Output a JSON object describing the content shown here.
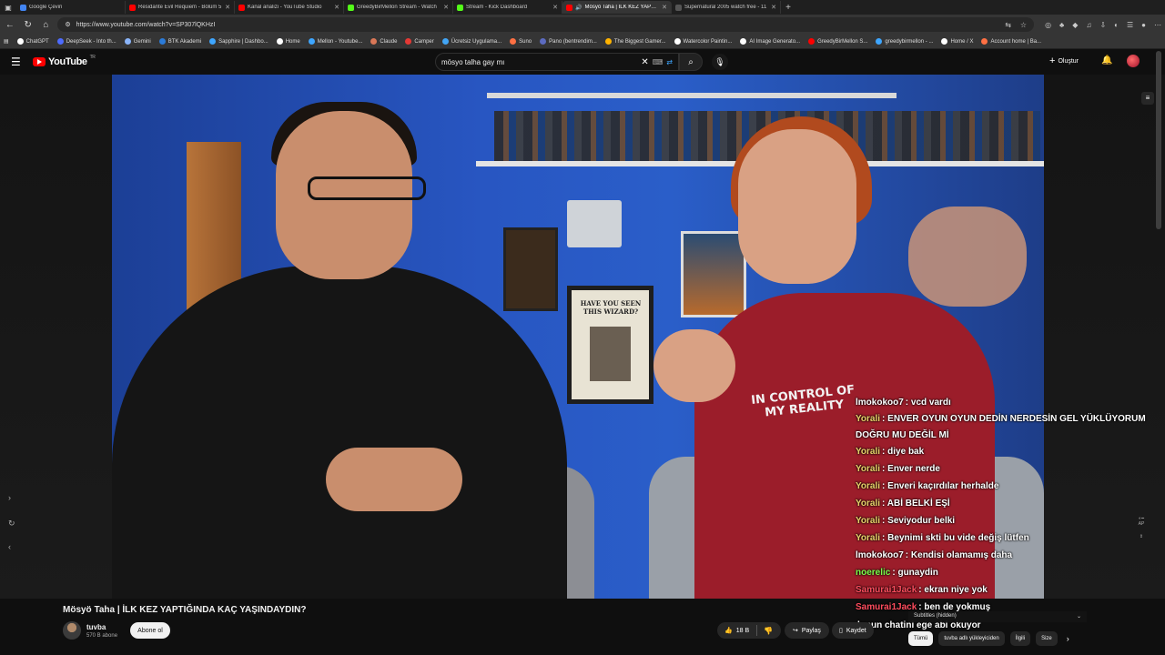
{
  "browser": {
    "tabs": [
      {
        "label": "Google Çeviri",
        "color": "#4285f4",
        "active": false
      },
      {
        "label": "Residante Evil Requiem - Bölüm 5",
        "color": "#ff0000",
        "active": false
      },
      {
        "label": "Kanal analizi - YouTube Studio",
        "color": "#ff0000",
        "active": false
      },
      {
        "label": "GreedyBirMellon Stream - Watch",
        "color": "#53fc18",
        "active": false
      },
      {
        "label": "Stream - Kick Dashboard",
        "color": "#53fc18",
        "active": false
      },
      {
        "label": "Mösyö Taha | İLK KEZ YAPTIĞ",
        "color": "#ff0000",
        "active": true
      },
      {
        "label": "Supernatural 2005 watch free - 11",
        "color": "#555555",
        "active": false
      }
    ],
    "url": "https://www.youtube.com/watch?v=SP307lQKHzI",
    "bookmarks": [
      {
        "label": "ChatGPT",
        "color": "#ffffff"
      },
      {
        "label": "DeepSeek - Into th...",
        "color": "#4d6bfe"
      },
      {
        "label": "Gemini",
        "color": "#8ab4f8"
      },
      {
        "label": "BTK Akademi",
        "color": "#2b7bd8"
      },
      {
        "label": "Sapphire | Dashbo...",
        "color": "#3ea6ff"
      },
      {
        "label": "Home",
        "color": "#ffffff"
      },
      {
        "label": "Mellon - Youtube...",
        "color": "#3ea6ff"
      },
      {
        "label": "Claude",
        "color": "#d97757"
      },
      {
        "label": "Camper",
        "color": "#e53935"
      },
      {
        "label": "Ücretsiz Uygulama...",
        "color": "#42a5f5"
      },
      {
        "label": "Suno",
        "color": "#ff7043"
      },
      {
        "label": "Pano (bentrendim...",
        "color": "#5c6bc0"
      },
      {
        "label": "The Biggest Gamer...",
        "color": "#ffb300"
      },
      {
        "label": "Watercolor Paintin...",
        "color": "#ffffff"
      },
      {
        "label": "AI Image Generato...",
        "color": "#ffffff"
      },
      {
        "label": "GreedyBirMellon S...",
        "color": "#ff0000"
      },
      {
        "label": "greedybirmellon - ...",
        "color": "#3ea6ff"
      },
      {
        "label": "Home / X",
        "color": "#ffffff"
      },
      {
        "label": "Account home | Ba...",
        "color": "#ff7043"
      }
    ]
  },
  "youtube": {
    "logo_text": "YouTube",
    "region": "TR",
    "search_value": "mösyo talha gay mı",
    "create_label": "Oluştur"
  },
  "video": {
    "shirt_text": "IN CONTROL OF MY REALITY",
    "poster_text": "HAVE YOU SEEN THIS WIZARD?",
    "title": "Mösyö Taha | İLK KEZ YAPTIĞINDA KAÇ YAŞINDAYDIN?",
    "channel": "tuvba",
    "subscribers": "570 B abone",
    "subscribe_label": "Abone ol",
    "likes": "18 B",
    "share_label": "Paylaş",
    "save_label": "Kaydet"
  },
  "chat": [
    {
      "name": "lmokokoo7",
      "color": "#ffffff",
      "text": ": vcd vardı"
    },
    {
      "name": "Yorali",
      "color": "#e8d26a",
      "text": ": ENVER OYUN OYUN DEDİN NERDESİN GEL YÜKLÜYORUM DOĞRU MU DEĞİL Mİ"
    },
    {
      "name": "Yorali",
      "color": "#e8d26a",
      "text": ": diye bak"
    },
    {
      "name": "Yorali",
      "color": "#e8d26a",
      "text": ": Enver nerde"
    },
    {
      "name": "Yorali",
      "color": "#e8d26a",
      "text": ": Enveri kaçırdılar herhalde"
    },
    {
      "name": "Yorali",
      "color": "#e8d26a",
      "text": ": ABİ BELKİ EŞİ"
    },
    {
      "name": "Yorali",
      "color": "#e8d26a",
      "text": ": Seviyodur belki"
    },
    {
      "name": "Yorali",
      "color": "#e8d26a",
      "text": ": Beynimi skti bu vide değiş lütfen"
    },
    {
      "name": "lmokokoo7",
      "color": "#ffffff",
      "text": ": Kendisi olamamış daha"
    },
    {
      "name": "noerelic",
      "color": "#7cff4a",
      "text": ": gunaydin"
    },
    {
      "name": "Samurai1Jack",
      "color": "#ff4d5e",
      "text": ": ekran niye yok"
    },
    {
      "name": "Samurai1Jack",
      "color": "#ff4d5e",
      "text": ": ben de yokmuş"
    },
    {
      "name": "",
      "color": "#ffffff",
      "text": "lonun chatini ege abi okuyor"
    }
  ],
  "side": {
    "subtitles_hidden": "Subtitles (hidden)",
    "ap_label": "AP"
  },
  "chips": [
    {
      "label": "Tümü",
      "active": true
    },
    {
      "label": "tuvba adlı yükleyiciden",
      "active": false
    },
    {
      "label": "İlgili",
      "active": false
    },
    {
      "label": "Size",
      "active": false
    }
  ]
}
